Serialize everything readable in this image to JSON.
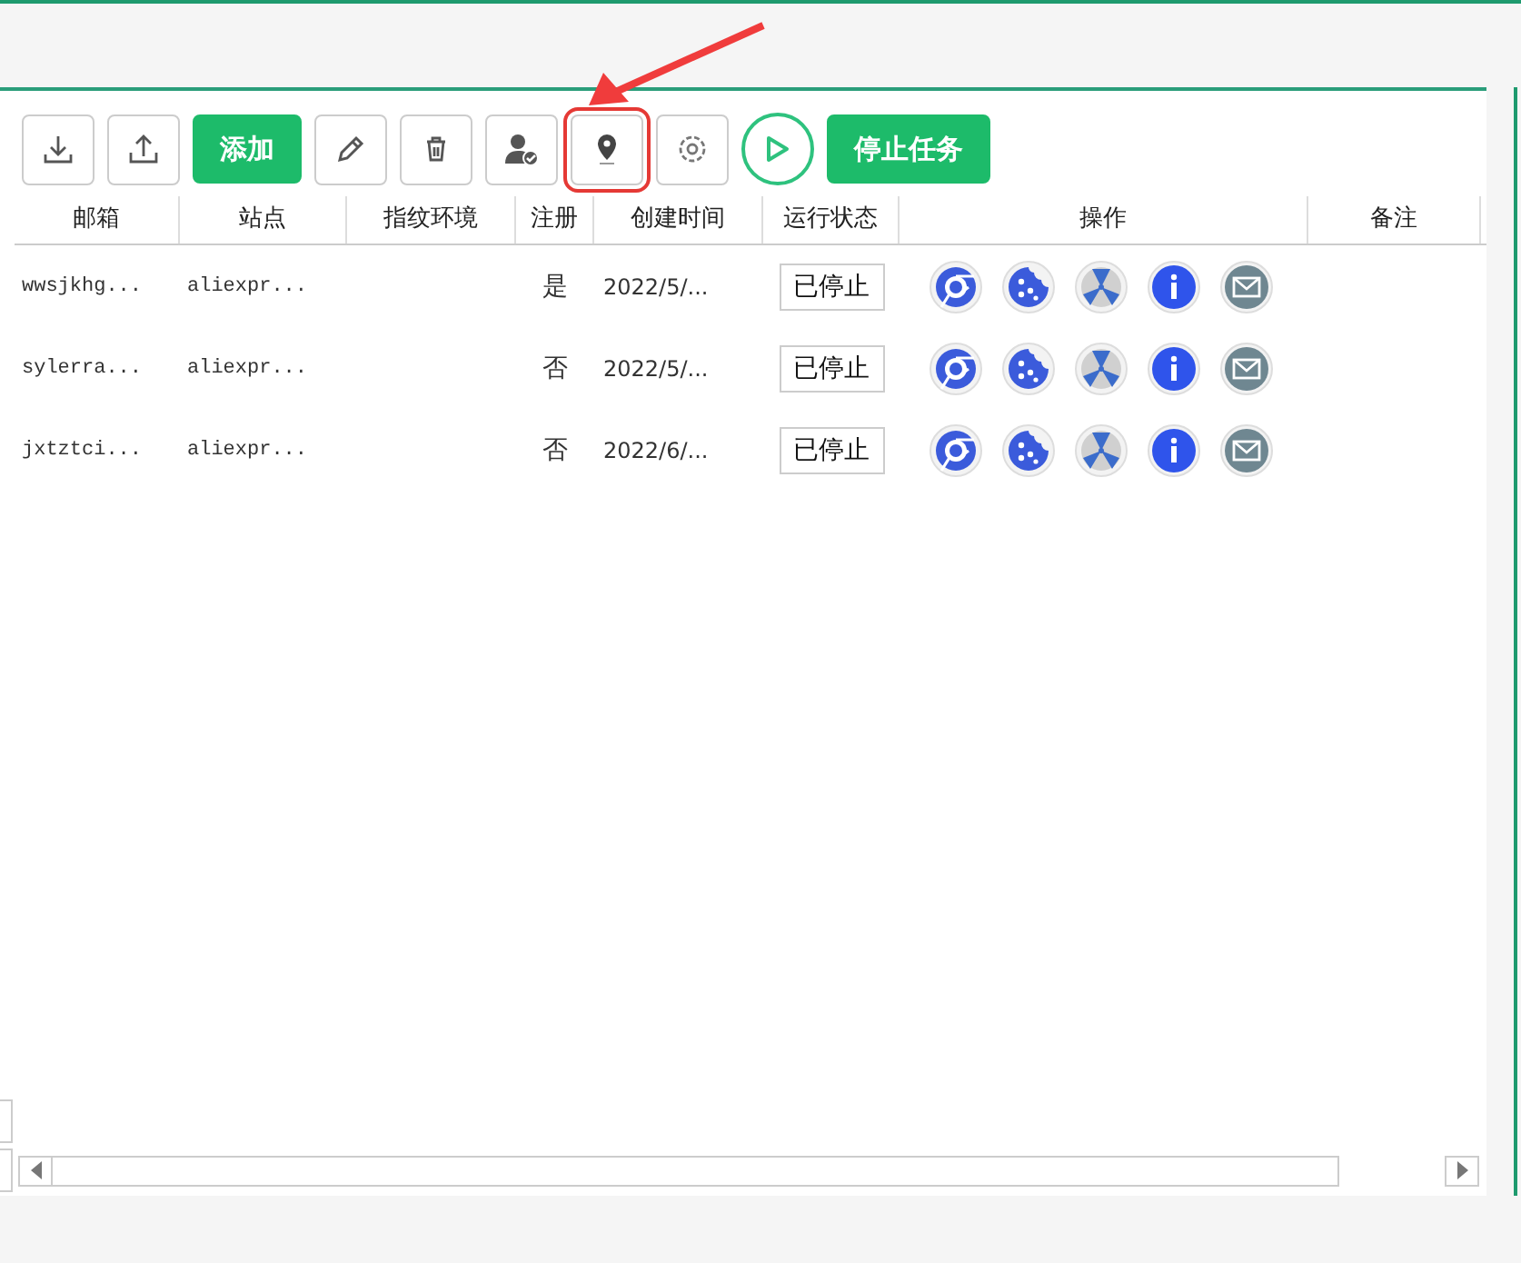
{
  "toolbar": {
    "add_button": "添加",
    "stop_button": "停止任务"
  },
  "table": {
    "columns": [
      "邮箱",
      "站点",
      "指纹环境",
      "注册",
      "创建时间",
      "运行状态",
      "操作",
      "备注"
    ],
    "rows": [
      {
        "email": "wwsjkhg...",
        "site": "aliexpr...",
        "registered": "是",
        "created": "2022/5/...",
        "status": "已停止"
      },
      {
        "email": "sylerra...",
        "site": "aliexpr...",
        "registered": "否",
        "created": "2022/5/...",
        "status": "已停止"
      },
      {
        "email": "jxtztci...",
        "site": "aliexpr...",
        "registered": "否",
        "created": "2022/6/...",
        "status": "已停止"
      }
    ]
  }
}
